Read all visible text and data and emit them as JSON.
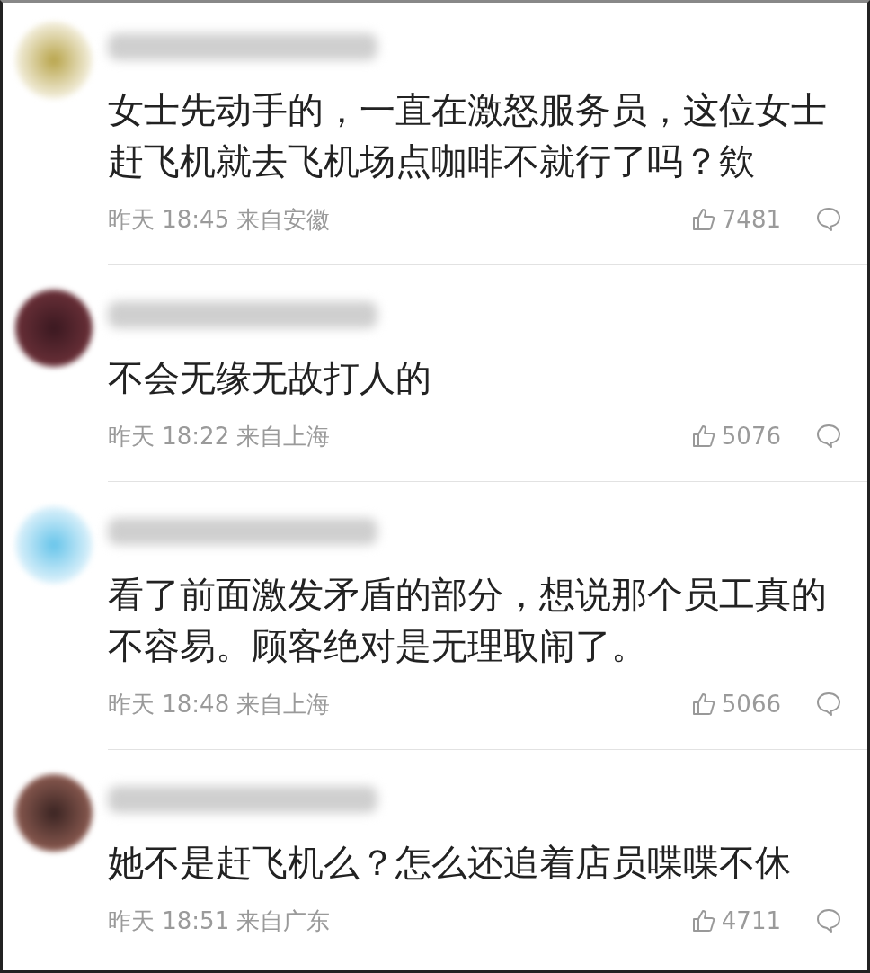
{
  "comments": [
    {
      "text": "女士先动手的，一直在激怒服务员，这位女士赶飞机就去飞机场点咖啡不就行了吗？欸",
      "meta": "昨天 18:45 来自安徽",
      "likes": "7481"
    },
    {
      "text": "不会无缘无故打人的",
      "meta": "昨天 18:22 来自上海",
      "likes": "5076"
    },
    {
      "text": "看了前面激发矛盾的部分，想说那个员工真的不容易。顾客绝对是无理取闹了。",
      "meta": "昨天 18:48 来自上海",
      "likes": "5066"
    },
    {
      "text": "她不是赶飞机么？怎么还追着店员喋喋不休",
      "meta": "昨天 18:51 来自广东",
      "likes": "4711"
    }
  ]
}
